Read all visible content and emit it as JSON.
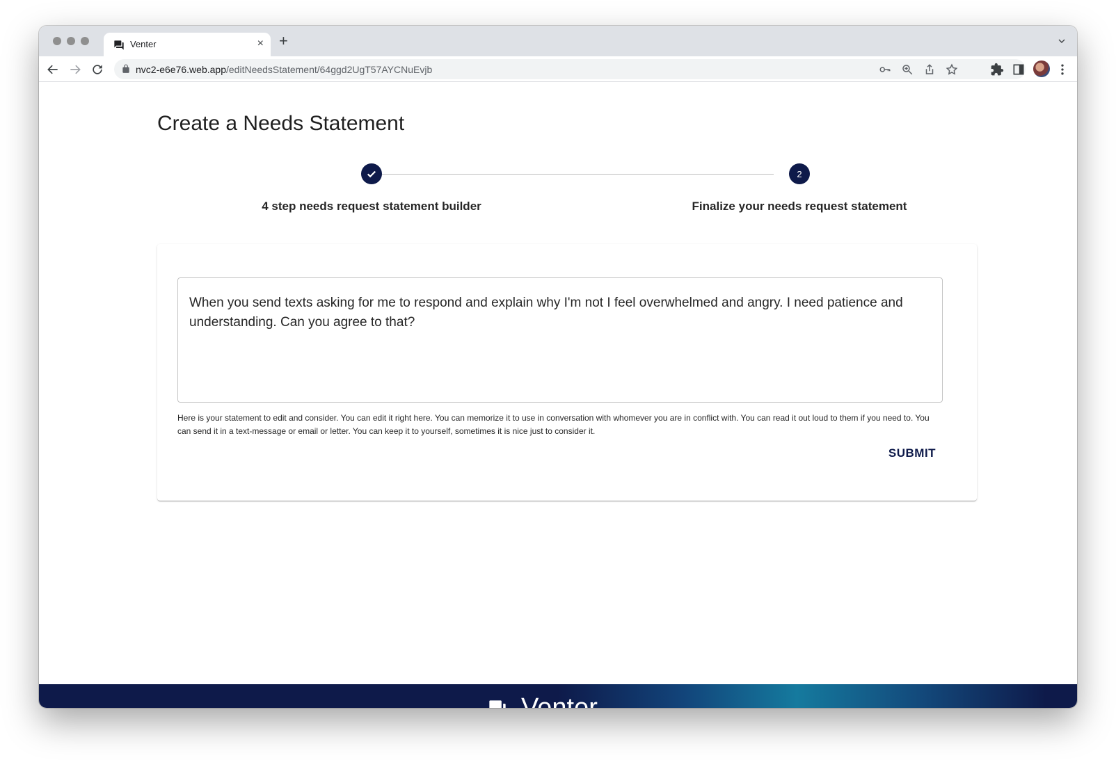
{
  "browser": {
    "tab_title": "Venter",
    "new_tab_symbol": "+",
    "close_symbol": "×",
    "url_host": "nvc2-e6e76.web.app",
    "url_path": "/editNeedsStatement/64ggd2UgT57AYCNuEvjb"
  },
  "page": {
    "title": "Create a Needs Statement",
    "stepper": {
      "steps": [
        {
          "label": "4 step needs request statement builder",
          "state": "complete",
          "icon": "check-icon"
        },
        {
          "label": "Finalize your needs request statement",
          "state": "active",
          "number": "2"
        }
      ]
    },
    "statement_value": "When you send texts asking for me to respond and explain why I'm not I feel overwhelmed and angry. I need patience and understanding. Can you agree to that?",
    "helper_text": "Here is your statement to edit and consider. You can edit it right here. You can memorize it to use in conversation with whomever you are in conflict with. You can read it out loud to them if you need to. You can send it in a text-message or email or letter. You can keep it to yourself, sometimes it is nice just to consider it.",
    "submit_label": "SUBMIT"
  },
  "footer": {
    "brand": "Venter",
    "icon": "chat-bubbles-icon"
  },
  "colors": {
    "primary": "#0e1a4a",
    "footer_gradient_highlight": "#157a9e"
  }
}
